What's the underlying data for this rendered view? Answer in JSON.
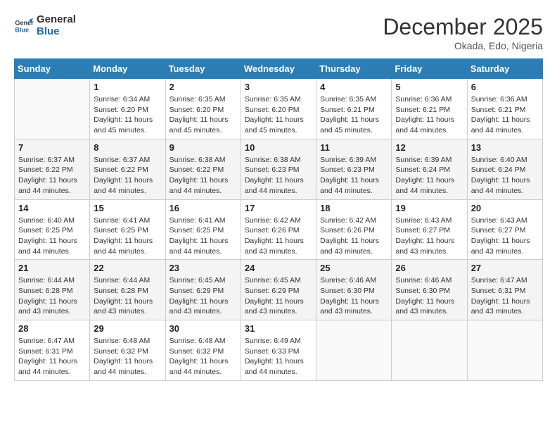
{
  "header": {
    "logo_line1": "General",
    "logo_line2": "Blue",
    "title": "December 2025",
    "subtitle": "Okada, Edo, Nigeria"
  },
  "columns": [
    "Sunday",
    "Monday",
    "Tuesday",
    "Wednesday",
    "Thursday",
    "Friday",
    "Saturday"
  ],
  "weeks": [
    [
      {
        "day": "",
        "info": ""
      },
      {
        "day": "1",
        "info": "Sunrise: 6:34 AM\nSunset: 6:20 PM\nDaylight: 11 hours and 45 minutes."
      },
      {
        "day": "2",
        "info": "Sunrise: 6:35 AM\nSunset: 6:20 PM\nDaylight: 11 hours and 45 minutes."
      },
      {
        "day": "3",
        "info": "Sunrise: 6:35 AM\nSunset: 6:20 PM\nDaylight: 11 hours and 45 minutes."
      },
      {
        "day": "4",
        "info": "Sunrise: 6:35 AM\nSunset: 6:21 PM\nDaylight: 11 hours and 45 minutes."
      },
      {
        "day": "5",
        "info": "Sunrise: 6:36 AM\nSunset: 6:21 PM\nDaylight: 11 hours and 44 minutes."
      },
      {
        "day": "6",
        "info": "Sunrise: 6:36 AM\nSunset: 6:21 PM\nDaylight: 11 hours and 44 minutes."
      }
    ],
    [
      {
        "day": "7",
        "info": "Sunrise: 6:37 AM\nSunset: 6:22 PM\nDaylight: 11 hours and 44 minutes."
      },
      {
        "day": "8",
        "info": "Sunrise: 6:37 AM\nSunset: 6:22 PM\nDaylight: 11 hours and 44 minutes."
      },
      {
        "day": "9",
        "info": "Sunrise: 6:38 AM\nSunset: 6:22 PM\nDaylight: 11 hours and 44 minutes."
      },
      {
        "day": "10",
        "info": "Sunrise: 6:38 AM\nSunset: 6:23 PM\nDaylight: 11 hours and 44 minutes."
      },
      {
        "day": "11",
        "info": "Sunrise: 6:39 AM\nSunset: 6:23 PM\nDaylight: 11 hours and 44 minutes."
      },
      {
        "day": "12",
        "info": "Sunrise: 6:39 AM\nSunset: 6:24 PM\nDaylight: 11 hours and 44 minutes."
      },
      {
        "day": "13",
        "info": "Sunrise: 6:40 AM\nSunset: 6:24 PM\nDaylight: 11 hours and 44 minutes."
      }
    ],
    [
      {
        "day": "14",
        "info": "Sunrise: 6:40 AM\nSunset: 6:25 PM\nDaylight: 11 hours and 44 minutes."
      },
      {
        "day": "15",
        "info": "Sunrise: 6:41 AM\nSunset: 6:25 PM\nDaylight: 11 hours and 44 minutes."
      },
      {
        "day": "16",
        "info": "Sunrise: 6:41 AM\nSunset: 6:25 PM\nDaylight: 11 hours and 44 minutes."
      },
      {
        "day": "17",
        "info": "Sunrise: 6:42 AM\nSunset: 6:26 PM\nDaylight: 11 hours and 43 minutes."
      },
      {
        "day": "18",
        "info": "Sunrise: 6:42 AM\nSunset: 6:26 PM\nDaylight: 11 hours and 43 minutes."
      },
      {
        "day": "19",
        "info": "Sunrise: 6:43 AM\nSunset: 6:27 PM\nDaylight: 11 hours and 43 minutes."
      },
      {
        "day": "20",
        "info": "Sunrise: 6:43 AM\nSunset: 6:27 PM\nDaylight: 11 hours and 43 minutes."
      }
    ],
    [
      {
        "day": "21",
        "info": "Sunrise: 6:44 AM\nSunset: 6:28 PM\nDaylight: 11 hours and 43 minutes."
      },
      {
        "day": "22",
        "info": "Sunrise: 6:44 AM\nSunset: 6:28 PM\nDaylight: 11 hours and 43 minutes."
      },
      {
        "day": "23",
        "info": "Sunrise: 6:45 AM\nSunset: 6:29 PM\nDaylight: 11 hours and 43 minutes."
      },
      {
        "day": "24",
        "info": "Sunrise: 6:45 AM\nSunset: 6:29 PM\nDaylight: 11 hours and 43 minutes."
      },
      {
        "day": "25",
        "info": "Sunrise: 6:46 AM\nSunset: 6:30 PM\nDaylight: 11 hours and 43 minutes."
      },
      {
        "day": "26",
        "info": "Sunrise: 6:46 AM\nSunset: 6:30 PM\nDaylight: 11 hours and 43 minutes."
      },
      {
        "day": "27",
        "info": "Sunrise: 6:47 AM\nSunset: 6:31 PM\nDaylight: 11 hours and 43 minutes."
      }
    ],
    [
      {
        "day": "28",
        "info": "Sunrise: 6:47 AM\nSunset: 6:31 PM\nDaylight: 11 hours and 44 minutes."
      },
      {
        "day": "29",
        "info": "Sunrise: 6:48 AM\nSunset: 6:32 PM\nDaylight: 11 hours and 44 minutes."
      },
      {
        "day": "30",
        "info": "Sunrise: 6:48 AM\nSunset: 6:32 PM\nDaylight: 11 hours and 44 minutes."
      },
      {
        "day": "31",
        "info": "Sunrise: 6:49 AM\nSunset: 6:33 PM\nDaylight: 11 hours and 44 minutes."
      },
      {
        "day": "",
        "info": ""
      },
      {
        "day": "",
        "info": ""
      },
      {
        "day": "",
        "info": ""
      }
    ]
  ]
}
